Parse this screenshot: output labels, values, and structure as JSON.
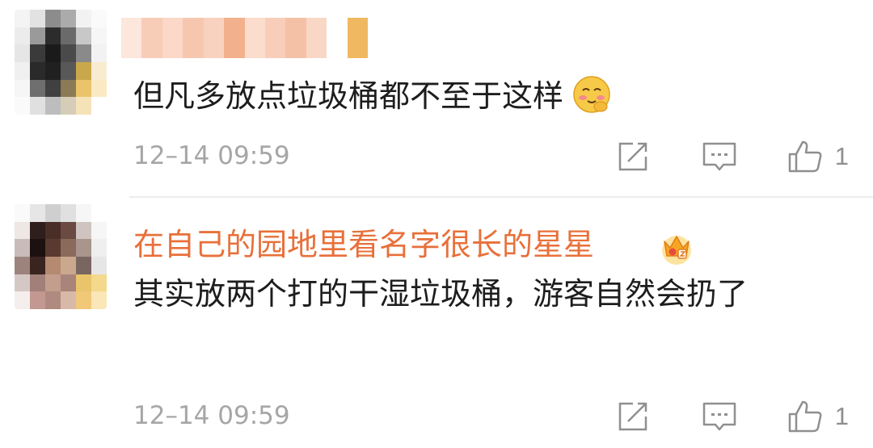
{
  "comments": [
    {
      "username": "",
      "text": "但凡多放点垃圾桶都不至于这样",
      "emoji": "blush-emoji-icon",
      "time": "12–14 09:59",
      "likes": "1"
    },
    {
      "username": "在自己的园地里看名字很长的星星",
      "badge": "vip-crown-badge-icon",
      "text": "其实放两个打的干湿垃圾桶，游客自然会扔了",
      "time": "12–14 09:59",
      "likes": "1"
    }
  ],
  "colors": {
    "username": "#e8703a",
    "text": "#1d1d1d",
    "meta": "#a6a6a6",
    "icon": "#8f8f8f"
  }
}
